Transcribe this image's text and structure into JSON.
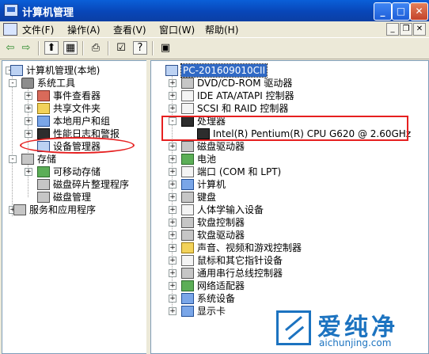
{
  "window": {
    "title": "计算机管理"
  },
  "menu": [
    "文件(F)",
    "操作(A)",
    "查看(V)",
    "窗口(W)",
    "帮助(H)"
  ],
  "left_tree": [
    {
      "label": "计算机管理(本地)",
      "icon": "computer-management-icon",
      "expander": "-"
    },
    {
      "label": "系统工具",
      "icon": "tools-icon",
      "expander": "-"
    },
    {
      "label": "事件查看器",
      "icon": "event-viewer-icon",
      "expander": "+"
    },
    {
      "label": "共享文件夹",
      "icon": "shared-folder-icon",
      "expander": "+"
    },
    {
      "label": "本地用户和组",
      "icon": "users-icon",
      "expander": "+"
    },
    {
      "label": "性能日志和警报",
      "icon": "performance-icon",
      "expander": "+"
    },
    {
      "label": "设备管理器",
      "icon": "device-manager-icon",
      "expander": ""
    },
    {
      "label": "存储",
      "icon": "storage-icon",
      "expander": "-"
    },
    {
      "label": "可移动存储",
      "icon": "removable-storage-icon",
      "expander": "+"
    },
    {
      "label": "磁盘碎片整理程序",
      "icon": "defrag-icon",
      "expander": ""
    },
    {
      "label": "磁盘管理",
      "icon": "disk-management-icon",
      "expander": ""
    },
    {
      "label": "服务和应用程序",
      "icon": "services-icon",
      "expander": "+"
    }
  ],
  "right_tree": {
    "root": "PC-201609010CII",
    "items": [
      {
        "label": "DVD/CD-ROM 驱动器",
        "icon": "dvd-icon",
        "expander": "+"
      },
      {
        "label": "IDE ATA/ATAPI 控制器",
        "icon": "ide-icon",
        "expander": "+"
      },
      {
        "label": "SCSI 和 RAID 控制器",
        "icon": "scsi-icon",
        "expander": "+"
      },
      {
        "label": "处理器",
        "icon": "processor-icon",
        "expander": "-"
      },
      {
        "label": "Intel(R) Pentium(R) CPU G620 @ 2.60GHz",
        "icon": "cpu-icon",
        "expander": "",
        "child": true
      },
      {
        "label": "磁盘驱动器",
        "icon": "disk-drive-icon",
        "expander": "+"
      },
      {
        "label": "电池",
        "icon": "battery-icon",
        "expander": "+"
      },
      {
        "label": "端口 (COM 和 LPT)",
        "icon": "port-icon",
        "expander": "+"
      },
      {
        "label": "计算机",
        "icon": "computer-icon",
        "expander": "+"
      },
      {
        "label": "键盘",
        "icon": "keyboard-icon",
        "expander": "+"
      },
      {
        "label": "人体学输入设备",
        "icon": "hid-icon",
        "expander": "+"
      },
      {
        "label": "软盘控制器",
        "icon": "floppy-controller-icon",
        "expander": "+"
      },
      {
        "label": "软盘驱动器",
        "icon": "floppy-drive-icon",
        "expander": "+"
      },
      {
        "label": "声音、视频和游戏控制器",
        "icon": "sound-icon",
        "expander": "+"
      },
      {
        "label": "鼠标和其它指针设备",
        "icon": "mouse-icon",
        "expander": "+"
      },
      {
        "label": "通用串行总线控制器",
        "icon": "usb-icon",
        "expander": "+"
      },
      {
        "label": "网络适配器",
        "icon": "network-icon",
        "expander": "+"
      },
      {
        "label": "系统设备",
        "icon": "system-device-icon",
        "expander": "+"
      },
      {
        "label": "显示卡",
        "icon": "display-icon",
        "expander": "+"
      }
    ]
  },
  "watermark": {
    "brand": "爱纯净",
    "url": "aichunjing.com"
  }
}
